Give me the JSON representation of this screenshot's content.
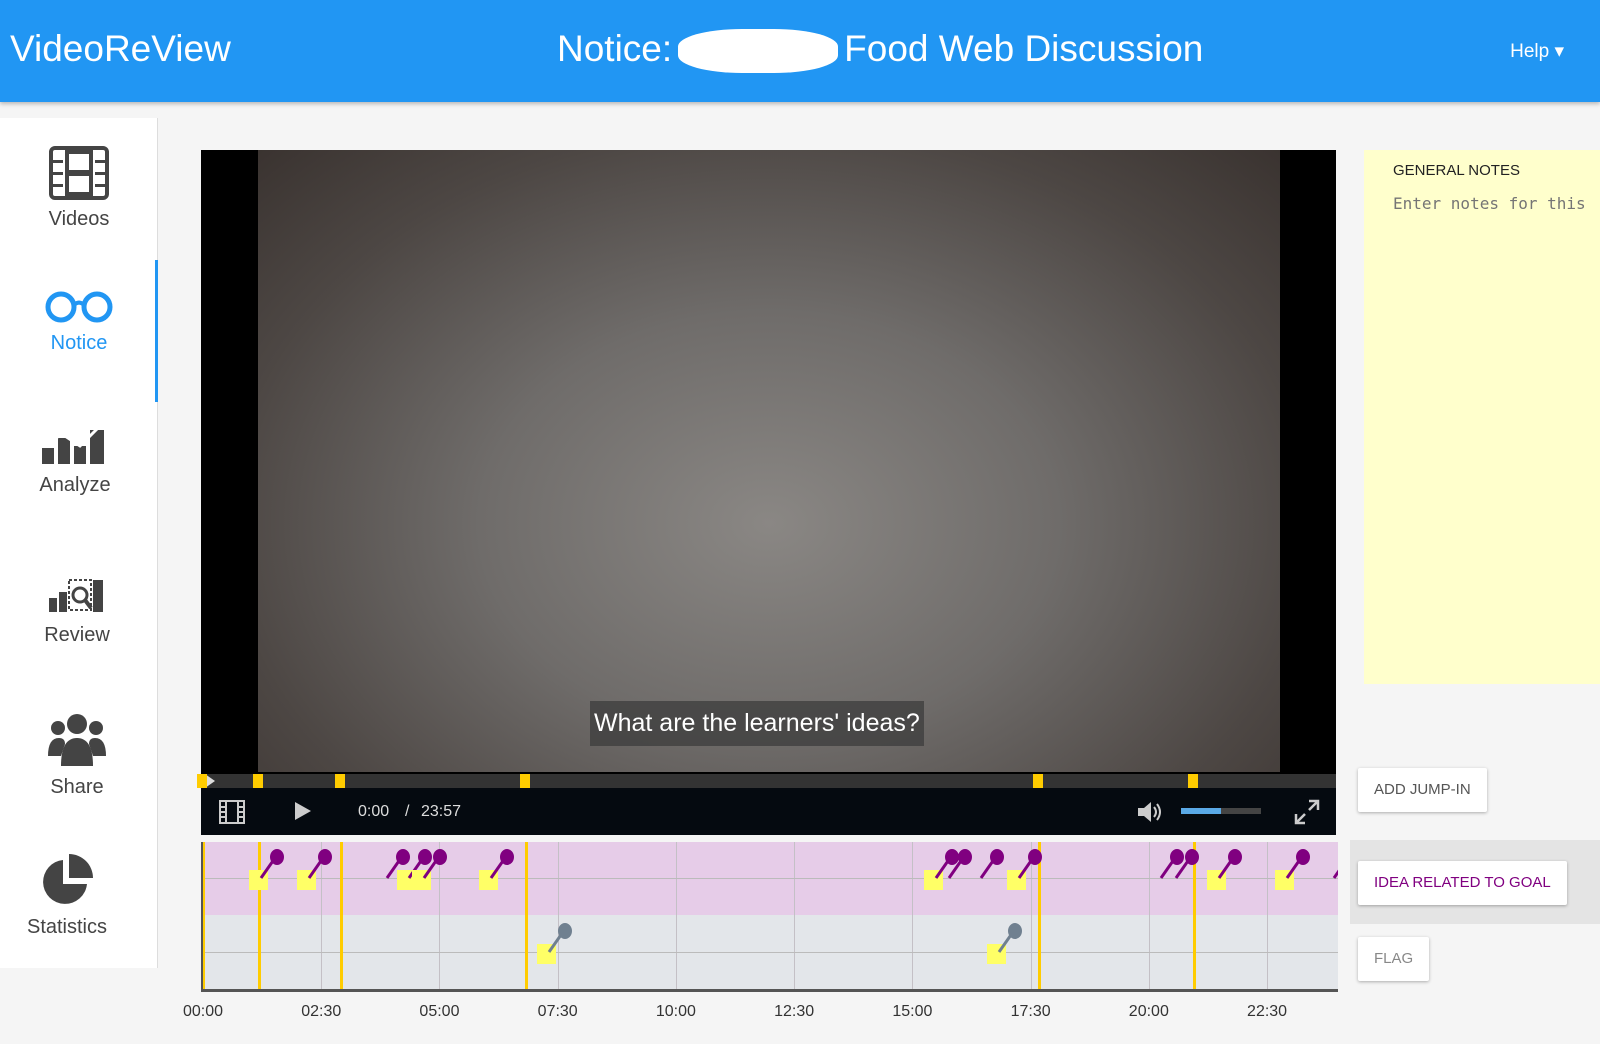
{
  "header": {
    "brand": "VideoReView",
    "title_prefix": "Notice:",
    "title_suffix": "Food Web Discussion",
    "help": "Help"
  },
  "sidebar": {
    "items": [
      {
        "label": "Videos",
        "icon": "film-icon"
      },
      {
        "label": "Notice",
        "icon": "glasses-icon",
        "active": true
      },
      {
        "label": "Analyze",
        "icon": "chart-icon"
      },
      {
        "label": "Review",
        "icon": "review-icon"
      },
      {
        "label": "Share",
        "icon": "users-icon"
      },
      {
        "label": "Statistics",
        "icon": "pie-icon"
      }
    ]
  },
  "video": {
    "caption": "What are the learners' ideas?",
    "current_time": "0:00",
    "separator": "/",
    "duration": "23:57",
    "volume": 0.5,
    "jump_ins": [
      "0:00",
      "1:11",
      "2:55",
      "6:50",
      "17:41",
      "20:57"
    ]
  },
  "notes": {
    "title": "GENERAL NOTES",
    "placeholder": "Enter notes for this video"
  },
  "buttons": {
    "add_jump_in": "ADD JUMP-IN",
    "idea": "IDEA RELATED TO GOAL",
    "flag": "FLAG"
  },
  "timeline": {
    "ticks": [
      "00:00",
      "02:30",
      "05:00",
      "07:30",
      "10:00",
      "12:30",
      "15:00",
      "17:30",
      "20:00",
      "22:30"
    ],
    "total_minutes": 24,
    "idea_color": "#800080",
    "flag_color": "#708090",
    "note_color": "#ffff66",
    "jump_color": "#ffcc00",
    "idea_markers": [
      {
        "t": "1:14",
        "note": true
      },
      {
        "t": "2:14",
        "note": true
      },
      {
        "t": "3:53",
        "note": false
      },
      {
        "t": "4:21",
        "note": true
      },
      {
        "t": "4:40",
        "note": true
      },
      {
        "t": "6:05",
        "note": true
      },
      {
        "t": "15:30",
        "note": true
      },
      {
        "t": "15:46",
        "note": false
      },
      {
        "t": "16:27",
        "note": false
      },
      {
        "t": "17:15",
        "note": true
      },
      {
        "t": "20:15",
        "note": false
      },
      {
        "t": "20:34",
        "note": false
      },
      {
        "t": "21:29",
        "note": true
      },
      {
        "t": "22:55",
        "note": true
      },
      {
        "t": "23:55",
        "note": false
      }
    ],
    "flag_markers": [
      {
        "t": "7:19",
        "note": true
      },
      {
        "t": "16:50",
        "note": true
      }
    ]
  }
}
